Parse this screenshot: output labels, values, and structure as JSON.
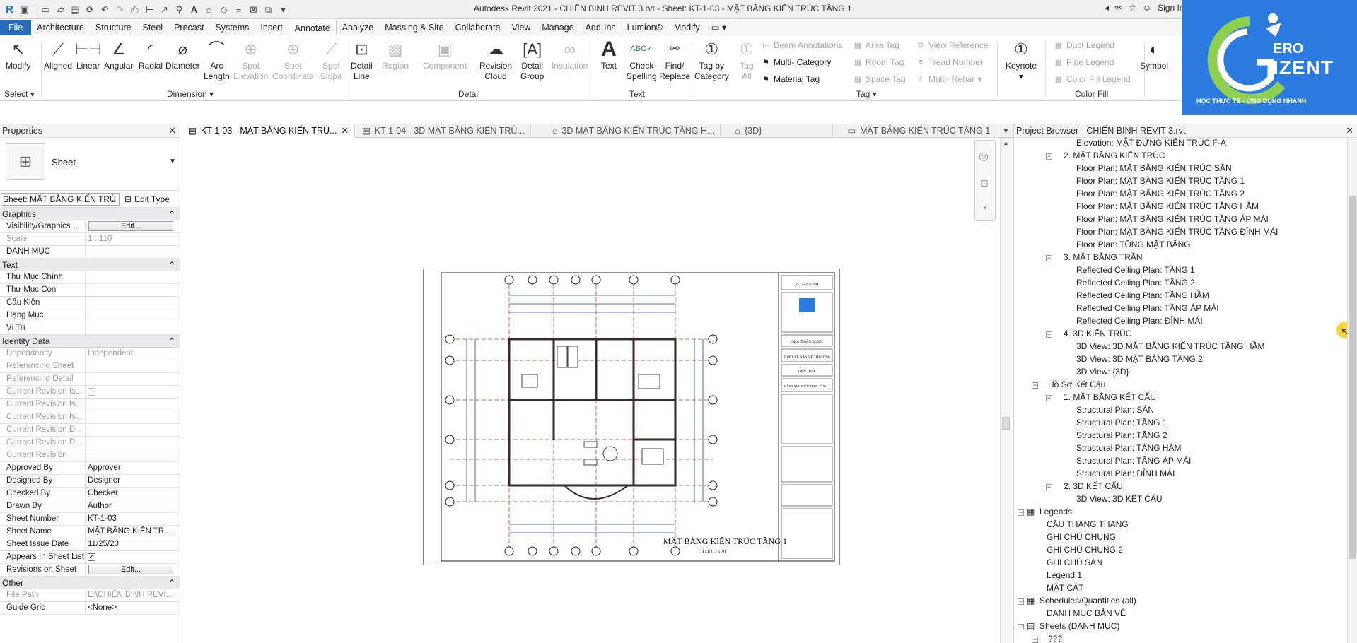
{
  "app": {
    "title": "Autodesk Revit 2021 - CHIẾN BINH REVIT 3.rvt - Sheet: KT-1-03 - MẶT BẰNG KIẾN TRÚC TẦNG 1",
    "sign_in": "Sign In"
  },
  "menu": [
    "File",
    "Architecture",
    "Structure",
    "Steel",
    "Precast",
    "Systems",
    "Insert",
    "Annotate",
    "Analyze",
    "Massing & Site",
    "Collaborate",
    "View",
    "Manage",
    "Add-Ins",
    "Lumion®",
    "Modify"
  ],
  "ribbon": {
    "modify": "Modify",
    "select": "Select",
    "aligned": "Aligned",
    "linear": "Linear",
    "angular": "Angular",
    "radial": "Radial",
    "diameter": "Diameter",
    "arc": "Arc",
    "length": "Length",
    "spot": "Spot",
    "elevation": "Elevation",
    "coordinate": "Coordinate",
    "slope": "Slope",
    "dimension": "Dimension",
    "detail": "Detail",
    "line": "Line",
    "region": "Region",
    "component": "Component",
    "revision": "Revision",
    "cloud": "Cloud",
    "group": "Group",
    "insulation": "Insulation",
    "detail_panel": "Detail",
    "text": "Text",
    "check": "Check",
    "spelling": "Spelling",
    "find": "Find/",
    "replace": "Replace",
    "text_panel": "Text",
    "tag_by": "Tag by",
    "category": "Category",
    "tag_all": "Tag",
    "all": "All",
    "beam_ann": "Beam  Annotations",
    "multi_cat": "Multi- Category",
    "material_tag": "Material  Tag",
    "area_tag": "Area  Tag",
    "room_tag": "Room  Tag",
    "space_tag": "Space  Tag",
    "view_ref": "View  Reference",
    "tread_num": "Tread  Number",
    "multi_rebar": "Multi- Rebar",
    "tag_panel": "Tag",
    "keynote": "Keynote",
    "duct_legend": "Duct  Legend",
    "pipe_legend": "Pipe  Legend",
    "color_fill_legend": "Color Fill  Legend",
    "color_fill_panel": "Color Fill",
    "symbol": "Symbol"
  },
  "logo": {
    "line1": "ERO",
    "line2": "IZENT",
    "tagline": "HỌC THỰC TẾ - ỨNG DỤNG NHANH"
  },
  "properties": {
    "header": "Properties",
    "type_name": "Sheet",
    "selector": "Sheet: MẶT BẰNG KIẾN TRÚ",
    "edit_type": "Edit Type",
    "groups": {
      "graphics": "Graphics",
      "text": "Text",
      "identity": "Identity Data",
      "other": "Other"
    },
    "rows": {
      "vis_graphics": "Visibility/Graphics ...",
      "edit": "Edit...",
      "scale": "Scale",
      "scale_val": "1 : 110",
      "danh_muc": "DANH MỤC",
      "thu_muc_chinh": "Thư Mục Chính",
      "thu_muc_con": "Thư Mục Con",
      "cau_kien": "Cấu Kiện",
      "hang_muc": "Hạng Mục",
      "vi_tri": "Vị Trí",
      "dependency": "Dependency",
      "dependency_val": "Independent",
      "ref_sheet": "Referencing Sheet",
      "ref_detail": "Referencing Detail",
      "cur_rev_is1": "Current Revision Is...",
      "cur_rev_is2": "Current Revision Is...",
      "cur_rev_is3": "Current Revision Is...",
      "cur_rev_d1": "Current Revision D...",
      "cur_rev_d2": "Current Revision D...",
      "cur_rev": "Current Revision",
      "approved_by": "Approved By",
      "approved_by_val": "Approver",
      "designed_by": "Designed By",
      "designed_by_val": "Designer",
      "checked_by": "Checked By",
      "checked_by_val": "Checker",
      "drawn_by": "Drawn By",
      "drawn_by_val": "Author",
      "sheet_number": "Sheet Number",
      "sheet_number_val": "KT-1-03",
      "sheet_name": "Sheet Name",
      "sheet_name_val": "MẶT BẰNG KIẾN TR...",
      "sheet_issue": "Sheet Issue Date",
      "sheet_issue_val": "11/25/20",
      "appears_in": "Appears In Sheet List",
      "revisions_on": "Revisions on Sheet",
      "file_path": "File Path",
      "file_path_val": "E:\\CHIẾN BINH REVI...",
      "guide_grid": "Guide Grid",
      "guide_grid_val": "<None>"
    }
  },
  "tabs": [
    "KT-1-03 - MẶT BẰNG KIẾN TRÚ...",
    "KT-1-04 - 3D MẶT BẰNG KIẾN TRÚ...",
    "3D MẶT BẰNG KIẾN TRÚC TẦNG H...",
    "{3D}",
    "MẶT BẰNG KIẾN TRÚC TẦNG 1"
  ],
  "sheet": {
    "title": "MẶT BẰNG KIẾN TRÚC TẦNG 1",
    "scale_note": "TỈ LỆ (1 : 110)",
    "tb_name": "VŨ VĂN VĨNH",
    "tb_project": "NHÀ Ở DÂN DỤNG",
    "tb_design": "THIẾT KẾ BẢN VẼ THI CÔNG",
    "tb_arch": "KIẾN TRÚC",
    "tb_sheet": "MẶT BẰNG KIẾN TRÚC TẦNG 1"
  },
  "browser": {
    "header": "Project Browser - CHIẾN BINH REVIT 3.rvt",
    "items": [
      "Elevation: MẶT ĐỨNG KIẾN TRÚC F-A",
      "2. MẶT BẰNG KIẾN TRÚC",
      "Floor Plan: MẶT BẰNG KIẾN TRÚC SÂN",
      "Floor Plan: MẶT BẰNG KIẾN TRÚC TẦNG 1",
      "Floor Plan: MẶT BẰNG KIẾN TRÚC TẦNG 2",
      "Floor Plan: MẶT BẰNG KIẾN TRÚC TẦNG HẦM",
      "Floor Plan: MẶT BẰNG KIẾN TRÚC TẦNG ÁP MÁI",
      "Floor Plan: MẶT BẰNG KIẾN TRÚC TẦNG ĐỈNH MÁI",
      "Floor Plan: TỔNG MẶT BẰNG",
      "3. MẶT BẰNG TRẦN",
      "Reflected Ceiling Plan: TẦNG 1",
      "Reflected Ceiling Plan: TẦNG 2",
      "Reflected Ceiling Plan: TẦNG HẦM",
      "Reflected Ceiling Plan: TẦNG ÁP MÁI",
      "Reflected Ceiling Plan: ĐỈNH MÁI",
      "4. 3D KIẾN TRÚC",
      "3D View: 3D MẶT BẰNG KIẾN TRÚC TẦNG HẦM",
      "3D View: 3D MẶT BẰNG TẦNG 2",
      "3D View: {3D}",
      "Hồ Sơ Kết Cấu",
      "1. MẶT BẰNG KẾT CẤU",
      "Structural Plan: SÂN",
      "Structural Plan: TẦNG 1",
      "Structural Plan: TẦNG 2",
      "Structural Plan: TẦNG HẦM",
      "Structural Plan: TẦNG ÁP MÁI",
      "Structural Plan: ĐỈNH MÁI",
      "2. 3D KẾT CẤU",
      "3D View: 3D KẾT CẤU",
      "Legends",
      "CẦU THANG THANG",
      "GHI CHÚ CHUNG",
      "GHI CHÚ CHUNG 2",
      "GHI CHÚ SÀN",
      "Legend 1",
      "MẶT CẮT",
      "Schedules/Quantities (all)",
      "DANH MỤC BẢN VẼ",
      "Sheets (DANH MỤC)",
      "???"
    ]
  },
  "colors": {
    "accent": "#2a6cbb",
    "logo_bg": "#2c7ce0",
    "plan_red": "#c0392b",
    "plan_blue": "#1f3fbf"
  }
}
